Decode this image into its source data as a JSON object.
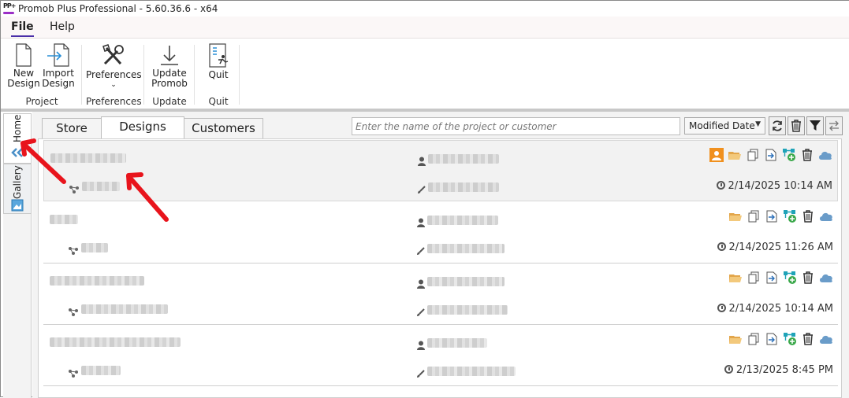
{
  "window": {
    "title": "Promob Plus Professional - 5.60.36.6 - x64",
    "logo_text": "PP+"
  },
  "menu": {
    "file": "File",
    "help": "Help"
  },
  "ribbon": {
    "new_design": [
      "New",
      "Design"
    ],
    "import_design": [
      "Import",
      "Design"
    ],
    "preferences": "Preferences",
    "update_promob": [
      "Update",
      "Promob"
    ],
    "quit": "Quit",
    "groups": {
      "project": "Project",
      "preferences": "Preferences",
      "update": "Update",
      "quit": "Quit"
    }
  },
  "side_tabs": {
    "home": "Home",
    "gallery": "Gallery"
  },
  "tabs": {
    "store": "Store",
    "designs": "Designs",
    "customers": "Customers",
    "active": "Designs"
  },
  "search": {
    "placeholder": "Enter the name of the project or customer"
  },
  "sort": {
    "selected": "Modified Date"
  },
  "designs": [
    {
      "modified": "2/14/2025 10:14 AM",
      "selected": true
    },
    {
      "modified": "2/14/2025 11:26 AM",
      "selected": false
    },
    {
      "modified": "2/14/2025 10:14 AM",
      "selected": false
    },
    {
      "modified": "2/13/2025 8:45 PM",
      "selected": false
    }
  ],
  "colors": {
    "accent": "#4a2fa8",
    "logo_bar": "#9b2fc6",
    "annotation_arrow": "#e8141c",
    "folder": "#e3a64b",
    "cloud": "#6a9cc9",
    "teal": "#1fa3b8"
  }
}
